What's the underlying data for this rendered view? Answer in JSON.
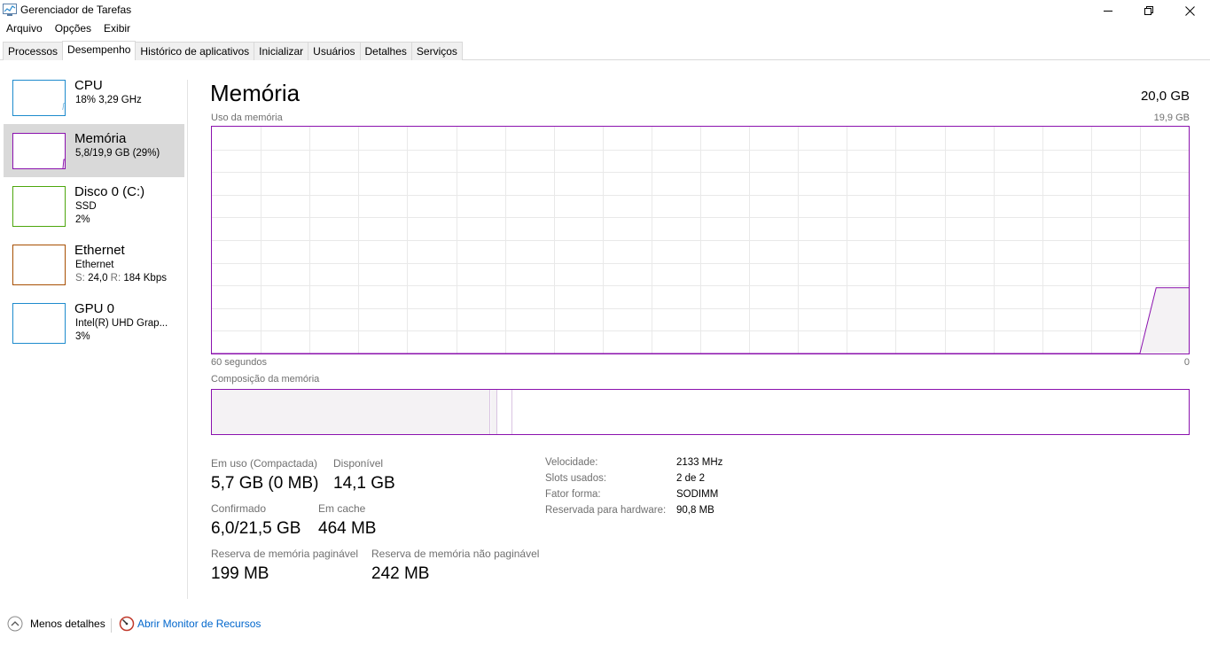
{
  "window": {
    "title": "Gerenciador de Tarefas"
  },
  "menu": [
    "Arquivo",
    "Opções",
    "Exibir"
  ],
  "tabs": [
    {
      "label": "Processos"
    },
    {
      "label": "Desempenho"
    },
    {
      "label": "Histórico de aplicativos"
    },
    {
      "label": "Inicializar"
    },
    {
      "label": "Usuários"
    },
    {
      "label": "Detalhes"
    },
    {
      "label": "Serviços"
    }
  ],
  "active_tab": "Desempenho",
  "sidebar": {
    "items": [
      {
        "title": "CPU",
        "sub1": "18% 3,29 GHz",
        "sub2": "",
        "color": "#1e8bcd"
      },
      {
        "title": "Memória",
        "sub1": "5,8/19,9 GB (29%)",
        "sub2": "",
        "color": "#8b12ae"
      },
      {
        "title": "Disco 0 (C:)",
        "sub1": "SSD",
        "sub2": "2%",
        "color": "#4da60c"
      },
      {
        "title": "Ethernet",
        "sub1": "Ethernet",
        "sub2_send_label": "S:",
        "sub2_send": "24,0",
        "sub2_recv_label": "R:",
        "sub2_recv": "184 Kbps",
        "color": "#a74f01"
      },
      {
        "title": "GPU 0",
        "sub1": "Intel(R) UHD Grap...",
        "sub2": "3%",
        "color": "#1e8bcd"
      }
    ]
  },
  "main": {
    "title": "Memória",
    "total": "20,0 GB",
    "usage_label": "Uso da memória",
    "usage_max": "19,9 GB",
    "x_left": "60 segundos",
    "x_right": "0",
    "composition_label": "Composição da memória",
    "stats": {
      "in_use_label": "Em uso (Compactada)",
      "in_use_value": "5,7 GB (0 MB)",
      "available_label": "Disponível",
      "available_value": "14,1 GB",
      "committed_label": "Confirmado",
      "committed_value": "6,0/21,5 GB",
      "cached_label": "Em cache",
      "cached_value": "464 MB",
      "paged_label": "Reserva de memória paginável",
      "paged_value": "199 MB",
      "nonpaged_label": "Reserva de memória não paginável",
      "nonpaged_value": "242 MB"
    },
    "specs": {
      "speed_label": "Velocidade:",
      "speed_value": "2133 MHz",
      "slots_label": "Slots usados:",
      "slots_value": "2 de 2",
      "form_label": "Fator forma:",
      "form_value": "SODIMM",
      "reserved_label": "Reservada para hardware:",
      "reserved_value": "90,8 MB"
    }
  },
  "chart_data": {
    "type": "area",
    "x": [
      60,
      3,
      2,
      0
    ],
    "values": [
      0,
      0,
      29,
      29
    ],
    "ylim": [
      0,
      100
    ],
    "xlim": [
      60,
      0
    ],
    "grid": true
  },
  "footer": {
    "less_details": "Menos detalhes",
    "resource_monitor": "Abrir Monitor de Recursos"
  },
  "colors": {
    "memory": "#8b12ae",
    "memory_fill": "#f4f2f4",
    "grid": "#e9e9e9"
  }
}
